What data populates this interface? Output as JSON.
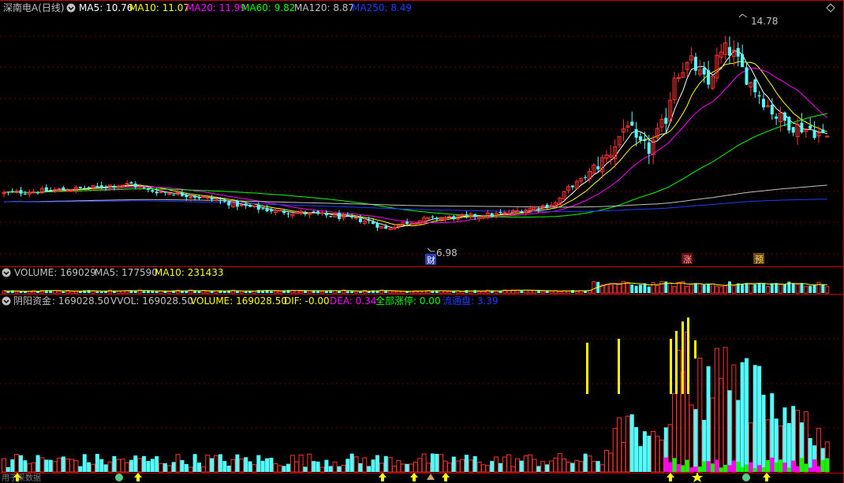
{
  "colors": {
    "up": "#ff3232",
    "down": "#54fcfc",
    "ma5": "#ffffff",
    "ma10": "#ffff00",
    "ma20": "#ff00ff",
    "ma60": "#00ff00",
    "ma120": "#c0c0c0",
    "ma250": "#1e3cff",
    "grid": "#7a0000",
    "separator": "#c80000",
    "stock_name": "#c0c0c0",
    "yellow_bar": "#ffff00",
    "magenta_bar": "#ff00ff",
    "green_bar": "#00ff00",
    "bottom_marker": "#ffff00"
  },
  "main_header": {
    "stock_name": "深南电A(日线)",
    "ma5": "MA5: 10.76",
    "ma10": "MA10: 11.07",
    "ma20": "MA20: 11.99",
    "ma60": "MA60: 9.82",
    "ma120": "MA120: 8.87",
    "ma250": "MA250: 8.49"
  },
  "annotations": {
    "high_label": "14.78",
    "low_label": "6.98",
    "tag_cai": "财",
    "tag_zhang": "涨",
    "tag_yu": "预"
  },
  "volume_header": {
    "volume": "VOLUME: 169029",
    "ma5": "MA5: 177590",
    "ma10": "MA10: 231433"
  },
  "indicator_header": {
    "name": "阴阳资金",
    "value": ": 169028.50",
    "vvol": "VVOL: 169028.50",
    "volume": "VOLUME: 169028.50",
    "dif": "DIF: -0.00",
    "dea": "DEA: 0.34",
    "zhangting": "全部涨停: 0.00",
    "liutong": "流通盘: 3.39"
  },
  "footer": {
    "loading_text": "用于采数据"
  },
  "chart_data": {
    "type": "candlestick",
    "title": "深南电A(日线)",
    "price_range": [
      6.0,
      15.5
    ],
    "price_high": 14.78,
    "price_low": 6.98,
    "ma_values": {
      "MA5": 10.76,
      "MA10": 11.07,
      "MA20": 11.99,
      "MA60": 9.82,
      "MA120": 8.87,
      "MA250": 8.49
    },
    "latest_volume": 169029,
    "volume_ma5": 177590,
    "volume_ma10": 231433,
    "indicator": {
      "name": "阴阳资金",
      "value": 169028.5,
      "VVOL": 169028.5,
      "VOLUME": 169028.5,
      "DIF": -0.0,
      "DEA": 0.34,
      "全部涨停": 0.0,
      "流通盘": 3.39
    },
    "close_trend": [
      [
        0,
        8.6
      ],
      [
        10,
        8.7
      ],
      [
        20,
        8.8
      ],
      [
        25,
        8.9
      ],
      [
        30,
        8.95
      ],
      [
        34,
        8.7
      ],
      [
        40,
        8.6
      ],
      [
        48,
        8.4
      ],
      [
        56,
        8.1
      ],
      [
        64,
        7.9
      ],
      [
        72,
        7.8
      ],
      [
        78,
        7.7
      ],
      [
        86,
        7.5
      ],
      [
        90,
        7.2
      ],
      [
        93,
        7.4
      ],
      [
        100,
        7.6
      ],
      [
        110,
        7.7
      ],
      [
        118,
        7.8
      ],
      [
        124,
        8.0
      ],
      [
        130,
        8.2
      ],
      [
        133,
        8.8
      ],
      [
        136,
        9.1
      ],
      [
        140,
        9.7
      ],
      [
        143,
        10.2
      ],
      [
        145,
        10.8
      ],
      [
        147,
        11.4
      ],
      [
        149,
        10.5
      ],
      [
        152,
        10.3
      ],
      [
        156,
        11.5
      ],
      [
        158,
        13.2
      ],
      [
        162,
        13.7
      ],
      [
        164,
        13.2
      ],
      [
        166,
        12.8
      ],
      [
        168,
        13.8
      ],
      [
        170,
        14.2
      ],
      [
        172,
        14.0
      ],
      [
        175,
        13.1
      ],
      [
        179,
        12.2
      ],
      [
        182,
        11.6
      ],
      [
        186,
        11.2
      ],
      [
        190,
        11.1
      ],
      [
        193,
        10.8
      ]
    ]
  }
}
